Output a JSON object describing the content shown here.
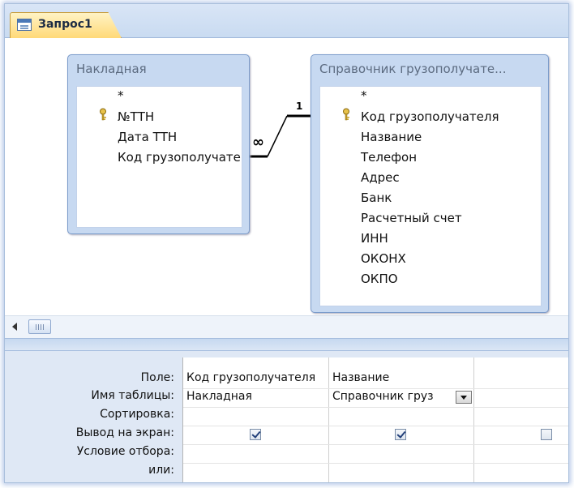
{
  "window": {
    "tab_label": "Запрос1"
  },
  "tables": [
    {
      "title": "Накладная",
      "fields": [
        "*",
        "№ТТН",
        "Дата ТТН",
        "Код грузополучате"
      ]
    },
    {
      "title": "Справочник грузополучате...",
      "fields": [
        "*",
        "Код грузополучателя",
        "Название",
        "Телефон",
        "Адрес",
        "Банк",
        "Расчетный счет",
        "ИНН",
        "ОКОНХ",
        "ОКПО"
      ]
    }
  ],
  "relationship": {
    "left_end": "∞",
    "right_end": "1"
  },
  "grid": {
    "row_labels": [
      "Поле:",
      "Имя таблицы:",
      "Сортировка:",
      "Вывод на экран:",
      "Условие отбора:",
      "или:"
    ],
    "columns": [
      {
        "field": "Код грузополучателя",
        "table": "Накладная",
        "show": true
      },
      {
        "field": "Название",
        "table": "Справочник груз",
        "show": true
      },
      {
        "field": "",
        "table": "",
        "show": false
      }
    ]
  }
}
